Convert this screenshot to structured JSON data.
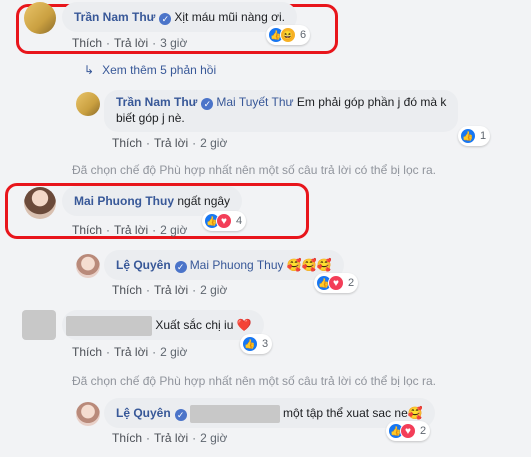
{
  "actions": {
    "like": "Thích",
    "reply": "Trả lời",
    "sep": "·"
  },
  "more_replies": "Xem thêm 5 phản hồi",
  "filter_note": "Đã chọn chế độ Phù hợp nhất nên một số câu trả lời có thể bị lọc ra.",
  "comments": [
    {
      "author": "Trần Nam Thư",
      "text": "Xịt máu mũi nàng ơi.",
      "time": "3 giờ",
      "reactions": "6"
    },
    {
      "author": "Trần Nam Thư",
      "mention": "Mai Tuyết Thư",
      "text_line1": "Em phải góp phần j đó mà k",
      "text_line2": "biết góp j nè.",
      "time": "2 giờ",
      "reactions": "1"
    },
    {
      "author": "Mai Phuong Thuy",
      "text": "ngất ngây",
      "time": "2 giờ",
      "reactions": "4"
    },
    {
      "author": "Lệ Quyên",
      "mention": "Mai Phuong Thuy",
      "text": "🥰🥰🥰",
      "time": "2 giờ",
      "reactions": "2"
    },
    {
      "text": "Xuất sắc chị iu ❤️",
      "time": "2 giờ",
      "reactions": "3"
    },
    {
      "author": "Lệ Quyên",
      "text": "một tập thể xuat sac ne🥰",
      "time": "2 giờ",
      "reactions": "2"
    }
  ],
  "colors": {
    "link": "#385898",
    "highlight": "#e8151b",
    "bubble": "#ebedf0",
    "background": "#f2f3f5"
  }
}
